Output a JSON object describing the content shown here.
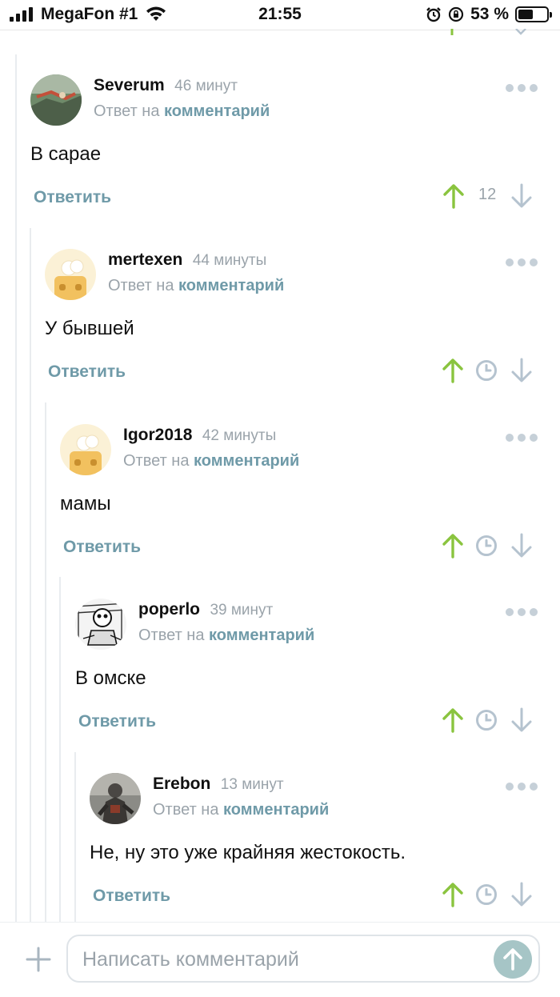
{
  "status_bar": {
    "carrier": "MegaFon #1",
    "time": "21:55",
    "battery": "53 %"
  },
  "comments": [
    {
      "author": "Severum",
      "ago": "46 минут",
      "reply_prefix": "Ответ на",
      "reply_link": "комментарий",
      "text": "В сарае",
      "reply_label": "Ответить",
      "rating": "12"
    },
    {
      "author": "mertexen",
      "ago": "44 минуты",
      "reply_prefix": "Ответ на",
      "reply_link": "комментарий",
      "text": "У бывшей",
      "reply_label": "Ответить"
    },
    {
      "author": "Igor2018",
      "ago": "42 минуты",
      "reply_prefix": "Ответ на",
      "reply_link": "комментарий",
      "text": "мамы",
      "reply_label": "Ответить"
    },
    {
      "author": "poperlo",
      "ago": "39 минут",
      "reply_prefix": "Ответ на",
      "reply_link": "комментарий",
      "text": "В омске",
      "reply_label": "Ответить"
    },
    {
      "author": "Erebon",
      "ago": "13 минут",
      "reply_prefix": "Ответ на",
      "reply_link": "комментарий",
      "text": "Не, ну это уже крайняя жестокость.",
      "reply_label": "Ответить"
    }
  ],
  "composer": {
    "placeholder": "Написать комментарий"
  },
  "colors": {
    "upvote": "#8ac43f",
    "downvote": "#b5c3cf",
    "link": "#6f9aa8",
    "muted": "#9aa3aa"
  }
}
